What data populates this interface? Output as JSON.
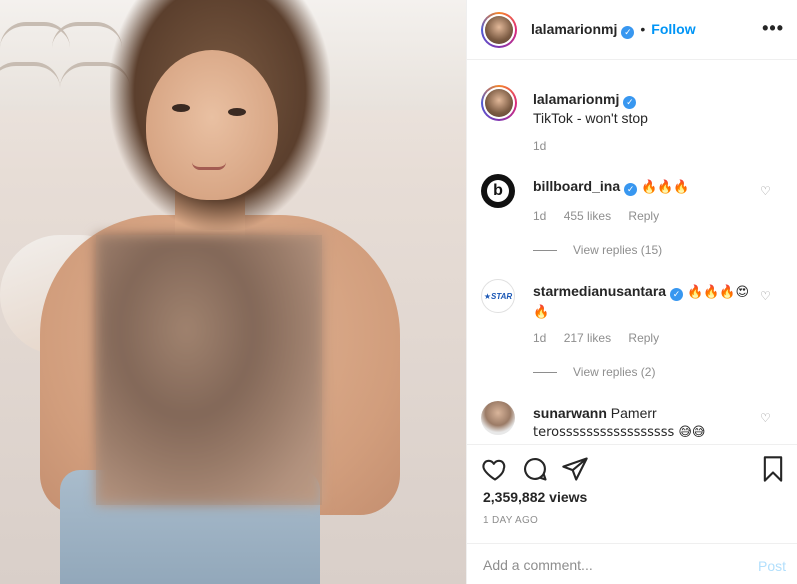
{
  "header": {
    "username": "lalamarionmj",
    "separator": "•",
    "follow_label": "Follow",
    "more_label": "•••"
  },
  "caption": {
    "username": "lalamarionmj",
    "text": "TikTok - won't stop",
    "age": "1d"
  },
  "comments": [
    {
      "username": "billboard_ina",
      "text": "🔥🔥🔥",
      "age": "1d",
      "likes": "455 likes",
      "reply_label": "Reply",
      "view_replies": "View replies (15)"
    },
    {
      "username": "starmedianusantara",
      "text": "🔥🔥🔥😍",
      "text_line2": "🔥",
      "age": "1d",
      "likes": "217 likes",
      "reply_label": "Reply",
      "view_replies": "View replies (2)"
    },
    {
      "username": "sunarwann",
      "text": "Pamerr",
      "text_line2": "terosssssssssssssssss 😅😅"
    }
  ],
  "stats": {
    "views": "2,359,882 views",
    "posted": "1 DAY AGO"
  },
  "add_comment": {
    "placeholder": "Add a comment...",
    "post_label": "Post"
  },
  "icons": {
    "verified": "verified-badge-icon",
    "like": "heart-icon",
    "comment": "comment-bubble-icon",
    "share": "paper-plane-icon",
    "save": "bookmark-icon"
  },
  "colors": {
    "accent": "#0095f6",
    "verified": "#3897f0",
    "muted": "#8e8e8e",
    "post_disabled": "#b2dffc"
  }
}
